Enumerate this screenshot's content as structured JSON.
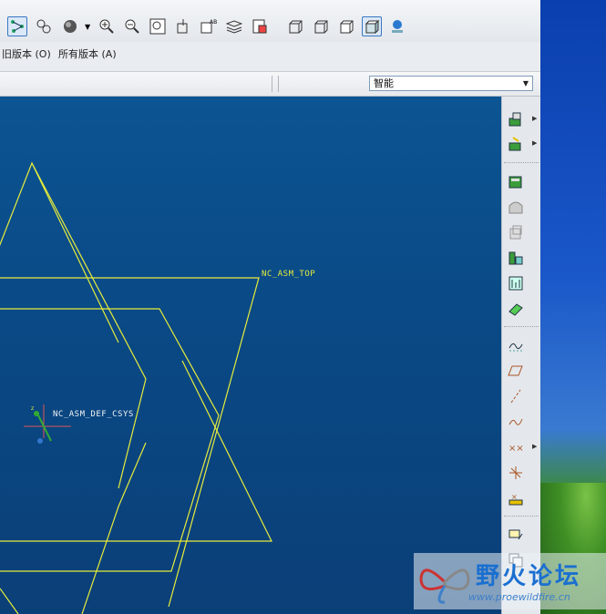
{
  "toolbar": {
    "icons": [
      "datum-display-icon",
      "datum-axis-icon",
      "spin-center-icon",
      "shading-icon",
      "zoom-in-icon",
      "zoom-out-icon",
      "refit-icon",
      "reorient-icon",
      "saved-views-icon",
      "layers-icon",
      "view-manager-icon",
      "wireframe-icon",
      "hidden-line-icon",
      "no-hidden-icon",
      "shaded-icon",
      "model-tree-icon"
    ]
  },
  "menu2": {
    "old_versions": "旧版本 (O)",
    "all_versions": "所有版本 (A)"
  },
  "filter": {
    "combo_value": "智能"
  },
  "viewport": {
    "labels": {
      "top_plane": "NC_ASM_TOP",
      "csys": "NC_ASM_DEF_CSYS"
    },
    "colors": {
      "datum": "#e6ec3c",
      "bg_top": "#0c5493",
      "bg_bottom": "#0b3f78"
    }
  },
  "rightbar": {
    "icons": [
      "assemble-icon",
      "mfg-setup-icon",
      "workpiece-icon",
      "solid-icon",
      "shell-icon",
      "rib-icon",
      "pattern-icon",
      "chamfer-icon",
      "datum-curve-icon",
      "datum-plane-icon",
      "datum-axis-icon",
      "sketch-curve-icon",
      "datum-point-icon",
      "csys-icon",
      "analysis-icon",
      "feature-icon",
      "copy-icon"
    ]
  },
  "watermark": {
    "title": "野火论坛",
    "url": "www.proewildfire.cn"
  }
}
